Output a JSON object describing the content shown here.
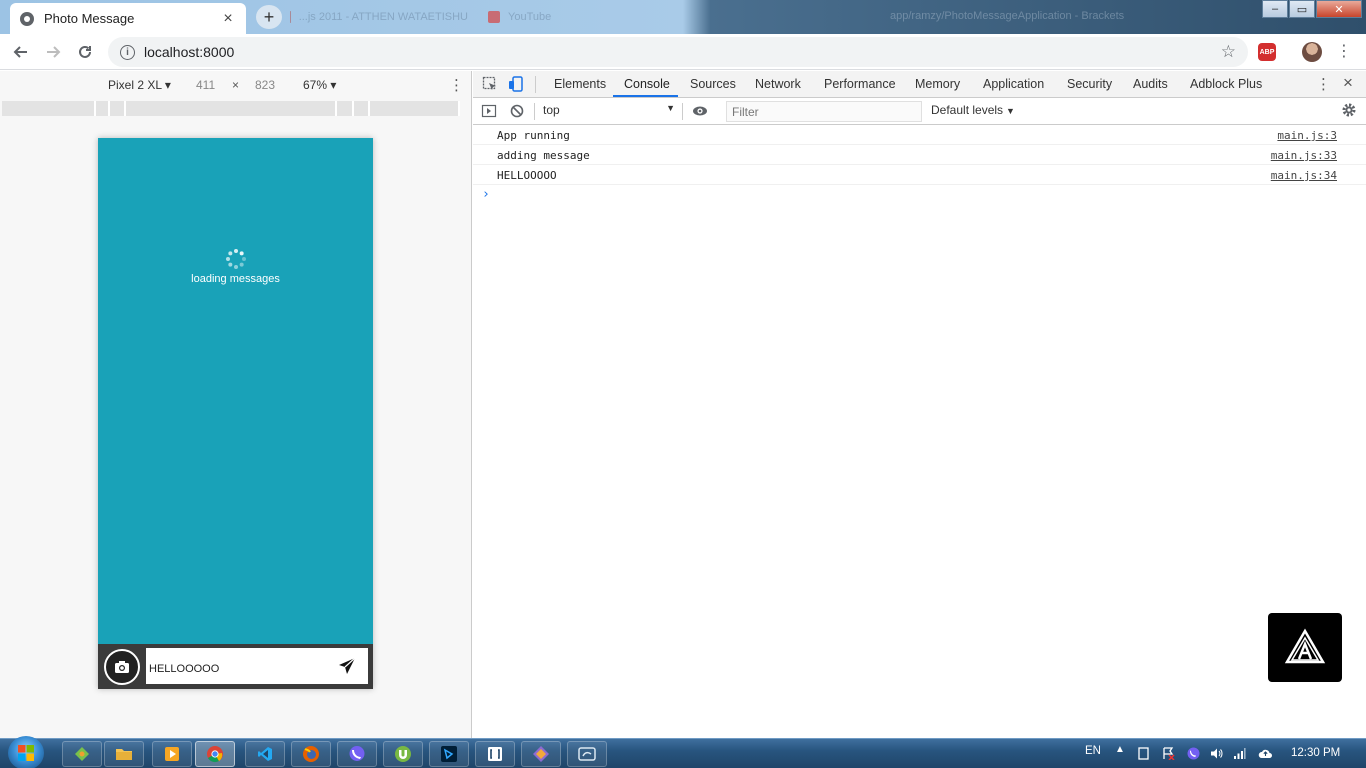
{
  "browser": {
    "active_tab": {
      "title": "Photo Message",
      "close": "×"
    },
    "new_tab_label": "+",
    "background_tabs": [
      {
        "title": "...js 2011 - ATTHEN WATAETISHU",
        "color": "#b05a5a"
      },
      {
        "title": "YouTube",
        "color": "#e62117"
      }
    ],
    "background_window_title": "app/ramzy/PhotoMessageApplication - Brackets",
    "window_controls": {
      "minimize": "–",
      "maximize": "▭",
      "close": "✕"
    },
    "url": "localhost:8000",
    "abp_label": "ABP"
  },
  "device_toolbar": {
    "device": "Pixel 2 XL",
    "width": "411",
    "times": "×",
    "height": "823",
    "zoom": "67%",
    "ruler_segments": [
      94,
      14,
      16,
      211,
      17,
      16,
      90
    ]
  },
  "app": {
    "loading_text": "loading messages",
    "message_value": "HELLOOOOO",
    "background_color": "#19a2b8"
  },
  "devtools": {
    "tabs": [
      "Elements",
      "Console",
      "Sources",
      "Network",
      "Performance",
      "Memory",
      "Application",
      "Security",
      "Audits",
      "Adblock Plus"
    ],
    "active_tab": "Console",
    "context": "top",
    "filter_placeholder": "Filter",
    "levels": "Default levels",
    "console": [
      {
        "message": "App running",
        "source": "main.js:3"
      },
      {
        "message": "adding message",
        "source": "main.js:33"
      },
      {
        "message": "HELLOOOOO",
        "source": "main.js:34"
      }
    ],
    "prompt": "›"
  },
  "taskbar": {
    "language": "EN",
    "time": "12:30 PM",
    "apps": [
      "gitkraken",
      "file-explorer",
      "media-player",
      "chrome",
      "vscode",
      "firefox",
      "viber",
      "utorrent",
      "photoshop",
      "brackets",
      "sourcetree",
      "app-window"
    ]
  }
}
